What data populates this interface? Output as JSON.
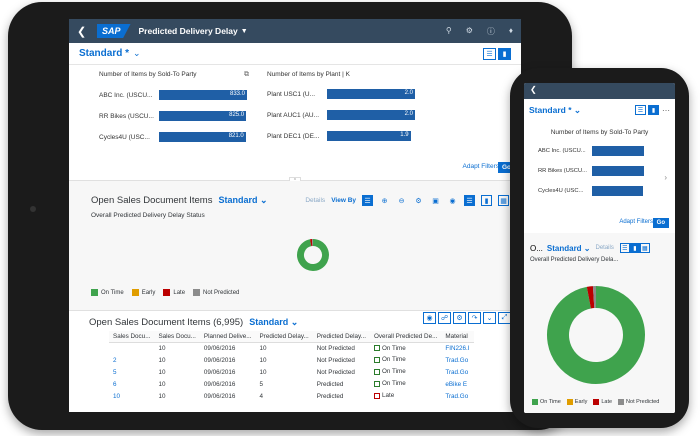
{
  "shell": {
    "logo": "SAP",
    "app_title": "Predicted Delivery Delay"
  },
  "variant": {
    "name": "Standard *",
    "phone_name": "Standard *"
  },
  "cards": {
    "sold_to": {
      "title": "Number of Items by Sold-To Party",
      "bars": [
        {
          "label": "ABC Inc. (USCU...",
          "value": 833.0,
          "display": "833.0"
        },
        {
          "label": "RR Bikes (USCU...",
          "value": 825.0,
          "display": "825.0"
        },
        {
          "label": "Cycles4U (USC...",
          "value": 821.0,
          "display": "821.0"
        }
      ]
    },
    "plant": {
      "title": "Number of Items by Plant  | K",
      "bars": [
        {
          "label": "Plant USC1 (U...",
          "value": 2.0,
          "display": "2.0"
        },
        {
          "label": "Plant AUC1 (AU...",
          "value": 2.0,
          "display": "2.0"
        },
        {
          "label": "Plant DEC1 (DE...",
          "value": 1.9,
          "display": "1.9"
        }
      ]
    },
    "phone_sold_to": {
      "title": "Number of Items by Sold-To Party",
      "bars": [
        {
          "label": "ABC Inc. (USCU...",
          "value": 833.0
        },
        {
          "label": "RR Bikes (USCU...",
          "value": 825.0
        },
        {
          "label": "Cycles4U (USC...",
          "value": 821.0
        }
      ]
    }
  },
  "filters": {
    "adapt_label": "Adapt Filters",
    "go_label": "Go"
  },
  "section1": {
    "title": "Open Sales Document Items",
    "variant": "Standard",
    "details_label": "Details",
    "view_by_label": "View By",
    "chart_title": "Overall Predicted Delivery Delay Status",
    "phone_title": "O...",
    "phone_details_label": "Details",
    "phone_chart_title": "Overall Predicted Delivery Dela..."
  },
  "legend": [
    {
      "label": "On Time",
      "color": "#3fa34d"
    },
    {
      "label": "Early",
      "color": "#e09d00"
    },
    {
      "label": "Late",
      "color": "#bb0000"
    },
    {
      "label": "Not Predicted",
      "color": "#8c8c8c"
    }
  ],
  "chart_data": [
    {
      "type": "pie",
      "title": "Overall Predicted Delivery Delay Status",
      "categories": [
        "On Time",
        "Early",
        "Late",
        "Not Predicted"
      ],
      "values": [
        97,
        0,
        2,
        1
      ]
    }
  ],
  "table": {
    "title": "Open Sales Document Items (6,995)",
    "variant": "Standard",
    "columns": [
      "Sales Docu...",
      "Sales Docu...",
      "Planned Delive...",
      "Predicted Delay...",
      "Predicted Delay...",
      "Overall Predicted De...",
      "Material"
    ],
    "rows": [
      [
        "",
        "10",
        "09/06/2016",
        "10",
        "Not Predicted",
        "On Time",
        "FIN226.I"
      ],
      [
        "2",
        "10",
        "09/06/2016",
        "10",
        "Not Predicted",
        "On Time",
        "Trad.Go"
      ],
      [
        "5",
        "10",
        "09/06/2016",
        "10",
        "Not Predicted",
        "On Time",
        "Trad.Go"
      ],
      [
        "6",
        "10",
        "09/06/2016",
        "5",
        "Predicted",
        "On Time",
        "eBike E"
      ],
      [
        "10",
        "10",
        "09/06/2016",
        "4",
        "Predicted",
        "Late",
        "Trad.Go"
      ]
    ]
  }
}
